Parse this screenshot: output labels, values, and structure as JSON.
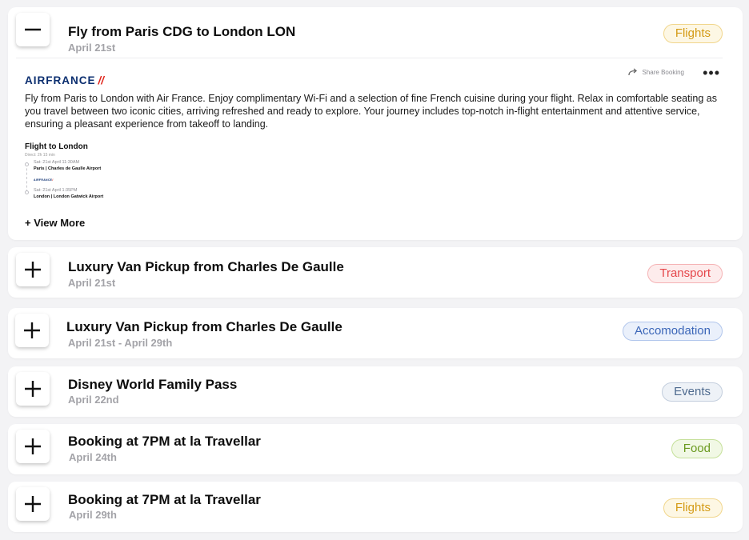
{
  "items": [
    {
      "title": "Fly from Paris CDG to London LON",
      "date": "April 21st",
      "badge": "Flights",
      "expanded": true,
      "details": {
        "brand": "AIRFRANCE",
        "share_label": "Share Booking",
        "more_label": "•••",
        "description": "Fly from Paris to London with Air France. Enjoy complimentary Wi-Fi and a selection of fine French cuisine during your flight. Relax in comfortable seating as you travel between two iconic cities, arriving refreshed and ready to explore. Your journey includes top-notch in-flight entertainment and attentive service, ensuring a pleasant experience from takeoff to landing.",
        "flight": {
          "heading": "Flight to London",
          "subheading": "Direct: 2h 15 min",
          "departure": {
            "time": "Sat: 21st April  11:30AM",
            "place": "Paris | Charles de Gaulle Airport"
          },
          "carrier": "AIRFRANCE",
          "arrival": {
            "time": "Sat: 21st April  1:35PM",
            "place": "London | London Gatwick Airport"
          }
        },
        "view_more": "+ View More"
      }
    },
    {
      "title": "Luxury Van Pickup from Charles De Gaulle",
      "date": "April 21st",
      "badge": "Transport",
      "expanded": false
    },
    {
      "title": "Luxury Van Pickup from Charles De Gaulle",
      "date": "April 21st - April 29th",
      "badge": "Accomodation",
      "expanded": false
    },
    {
      "title": "Disney World Family Pass",
      "date": "April 22nd",
      "badge": "Events",
      "expanded": false
    },
    {
      "title": "Booking at 7PM at la Travellar",
      "date": "April 24th",
      "badge": "Food",
      "expanded": false
    },
    {
      "title": "Booking at 7PM at la Travellar",
      "date": "April 29th",
      "badge": "Flights",
      "expanded": false
    }
  ],
  "badge_colors": {
    "Flights": {
      "text": "#d49b16",
      "bg": "#fdf7e4",
      "border": "#f1d68c"
    },
    "Transport": {
      "text": "#e5474b",
      "bg": "#fdecec",
      "border": "#f5b3b5"
    },
    "Accomodation": {
      "text": "#3b66b8",
      "bg": "#eaf0fb",
      "border": "#b1c6ec"
    },
    "Events": {
      "text": "#4f6b8f",
      "bg": "#eef2f7",
      "border": "#c3cedd"
    },
    "Food": {
      "text": "#6a9a1f",
      "bg": "#f1f8e5",
      "border": "#c5e09a"
    }
  },
  "icons": {
    "expanded": "minus-icon",
    "collapsed": "plus-icon",
    "share": "share-arrow-icon",
    "more": "more-dots-icon"
  }
}
